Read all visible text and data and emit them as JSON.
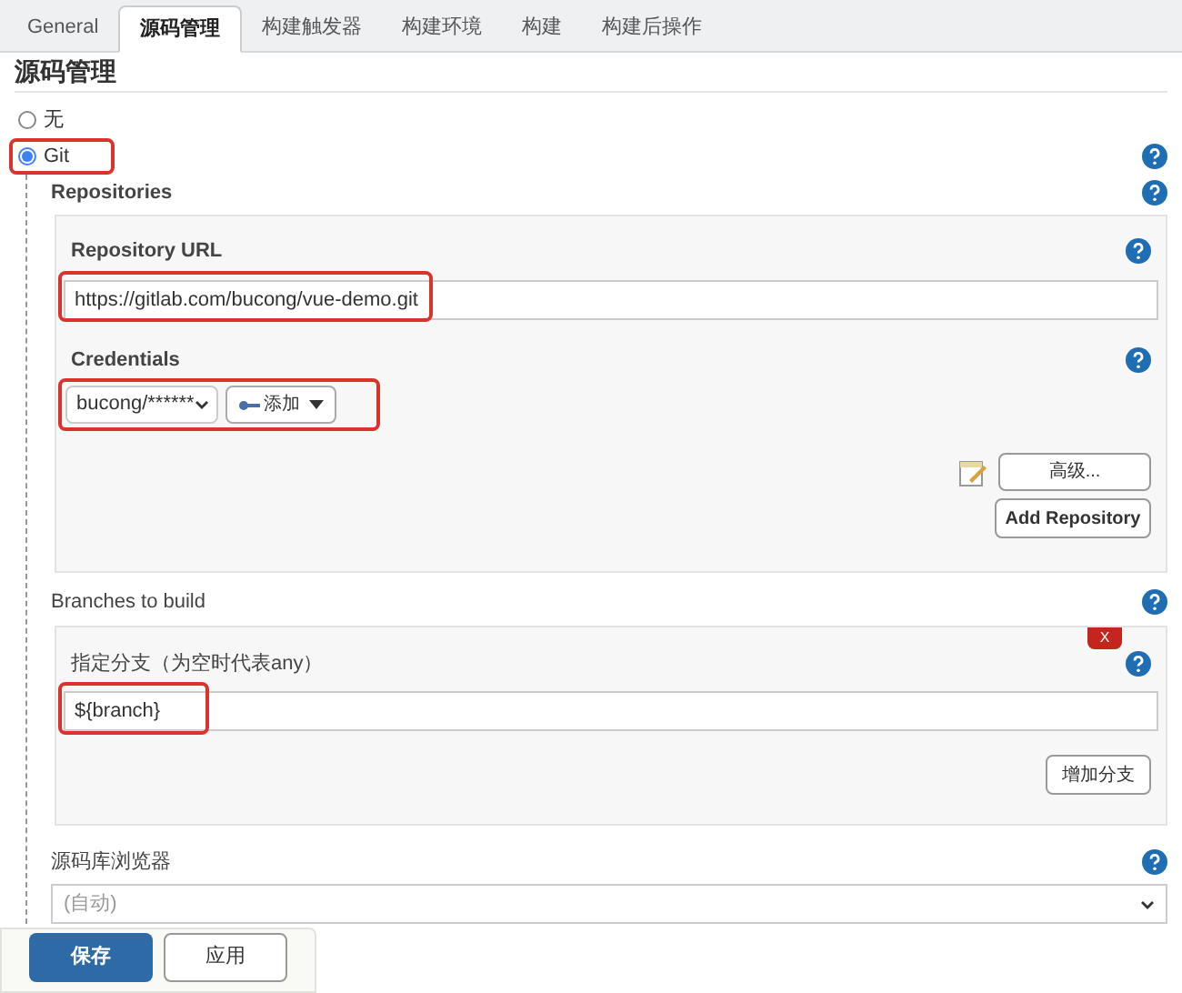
{
  "tabs": [
    {
      "label": "General",
      "selected": false
    },
    {
      "label": "源码管理",
      "selected": true
    },
    {
      "label": "构建触发器",
      "selected": false
    },
    {
      "label": "构建环境",
      "selected": false
    },
    {
      "label": "构建",
      "selected": false
    },
    {
      "label": "构建后操作",
      "selected": false
    }
  ],
  "section_title": "源码管理",
  "scm_options": [
    {
      "label": "无",
      "selected": false,
      "highlighted": false
    },
    {
      "label": "Git",
      "selected": true,
      "highlighted": true
    }
  ],
  "repositories": {
    "label": "Repositories",
    "repository_url": {
      "label": "Repository URL",
      "value": "https://gitlab.com/bucong/vue-demo.git",
      "highlighted": true
    },
    "credentials": {
      "label": "Credentials",
      "value": "bucong/******",
      "add_button": "添加",
      "highlighted": true
    },
    "advanced_button": "高级...",
    "add_repository_button": "Add Repository"
  },
  "branches": {
    "label": "Branches to build",
    "delete_button": "X",
    "branch_field": {
      "label": "指定分支（为空时代表any）",
      "value": "${branch}",
      "highlighted": true
    },
    "add_branch_button": "增加分支"
  },
  "browser": {
    "label": "源码库浏览器",
    "value": "(自动)"
  },
  "footer_buttons": [
    {
      "label": "保存",
      "kind": "primary"
    },
    {
      "label": "应用",
      "kind": "secondary"
    }
  ]
}
